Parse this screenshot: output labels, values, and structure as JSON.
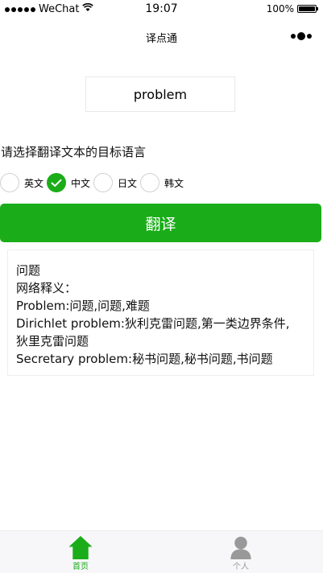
{
  "status_bar": {
    "carrier": "WeChat",
    "time": "19:07",
    "battery": "100%"
  },
  "nav": {
    "title": "译点通"
  },
  "input": {
    "value": "problem"
  },
  "prompt": "请选择翻译文本的目标语言",
  "languages": [
    {
      "label": "英文",
      "checked": false
    },
    {
      "label": "中文",
      "checked": true
    },
    {
      "label": "日文",
      "checked": false
    },
    {
      "label": "韩文",
      "checked": false
    }
  ],
  "translate_button": "翻译",
  "result": {
    "main": "问题",
    "web_header": "网络释义：",
    "lines": [
      "Problem:问题,问题,难题",
      "Dirichlet problem:狄利克雷问题,第一类边界条件,",
      "狄里克雷问题",
      "Secretary problem:秘书问题,秘书问题,书问题"
    ]
  },
  "tabbar": {
    "home_label": "首页",
    "me_label": "个人",
    "active_color": "#1aad19",
    "inactive_color": "#999999"
  },
  "colors": {
    "accent": "#1aad19"
  }
}
